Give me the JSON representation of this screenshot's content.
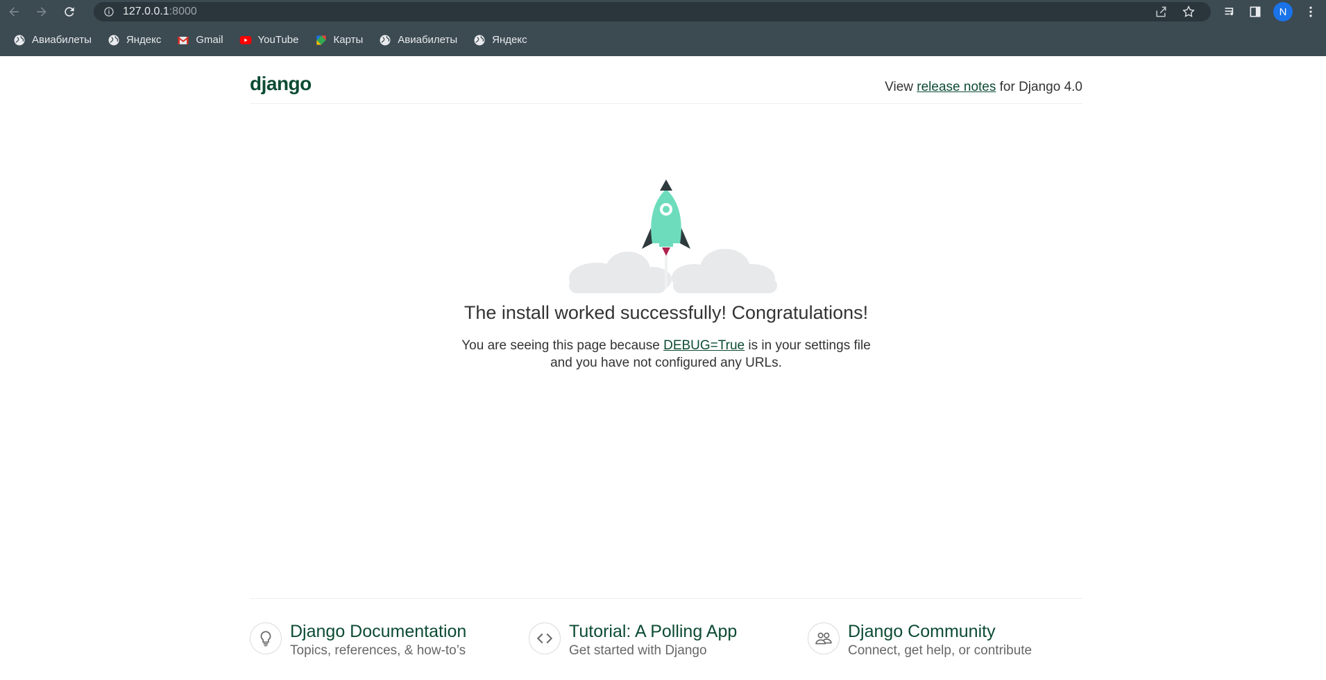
{
  "browser": {
    "url_host": "127.0.0.1",
    "url_port": ":8000",
    "profile_initial": "N"
  },
  "bookmarks": [
    {
      "label": "Авиабилеты",
      "icon": "globe-icon"
    },
    {
      "label": "Яндекс",
      "icon": "globe-icon"
    },
    {
      "label": "Gmail",
      "icon": "gmail-icon"
    },
    {
      "label": "YouTube",
      "icon": "youtube-icon"
    },
    {
      "label": "Карты",
      "icon": "maps-icon"
    },
    {
      "label": "Авиабилеты",
      "icon": "globe-icon"
    },
    {
      "label": "Яндекс",
      "icon": "globe-icon"
    }
  ],
  "header": {
    "logo": "django",
    "release_prefix": "View ",
    "release_link": "release notes",
    "release_suffix": " for Django 4.0"
  },
  "main": {
    "title": "The install worked successfully! Congratulations!",
    "sub_prefix": "You are seeing this page because ",
    "sub_link": "DEBUG=True",
    "sub_suffix": " is in your settings file and you have not configured any URLs."
  },
  "footer": {
    "cards": [
      {
        "title": "Django Documentation",
        "subtitle": "Topics, references, & how-to’s",
        "icon": "lightbulb-icon"
      },
      {
        "title": "Tutorial: A Polling App",
        "subtitle": "Get started with Django",
        "icon": "code-icon"
      },
      {
        "title": "Django Community",
        "subtitle": "Connect, get help, or contribute",
        "icon": "community-icon"
      }
    ]
  },
  "colors": {
    "chrome": "#3c4a52",
    "django_green": "#0c4b33",
    "rocket": "#6ddcbd"
  }
}
